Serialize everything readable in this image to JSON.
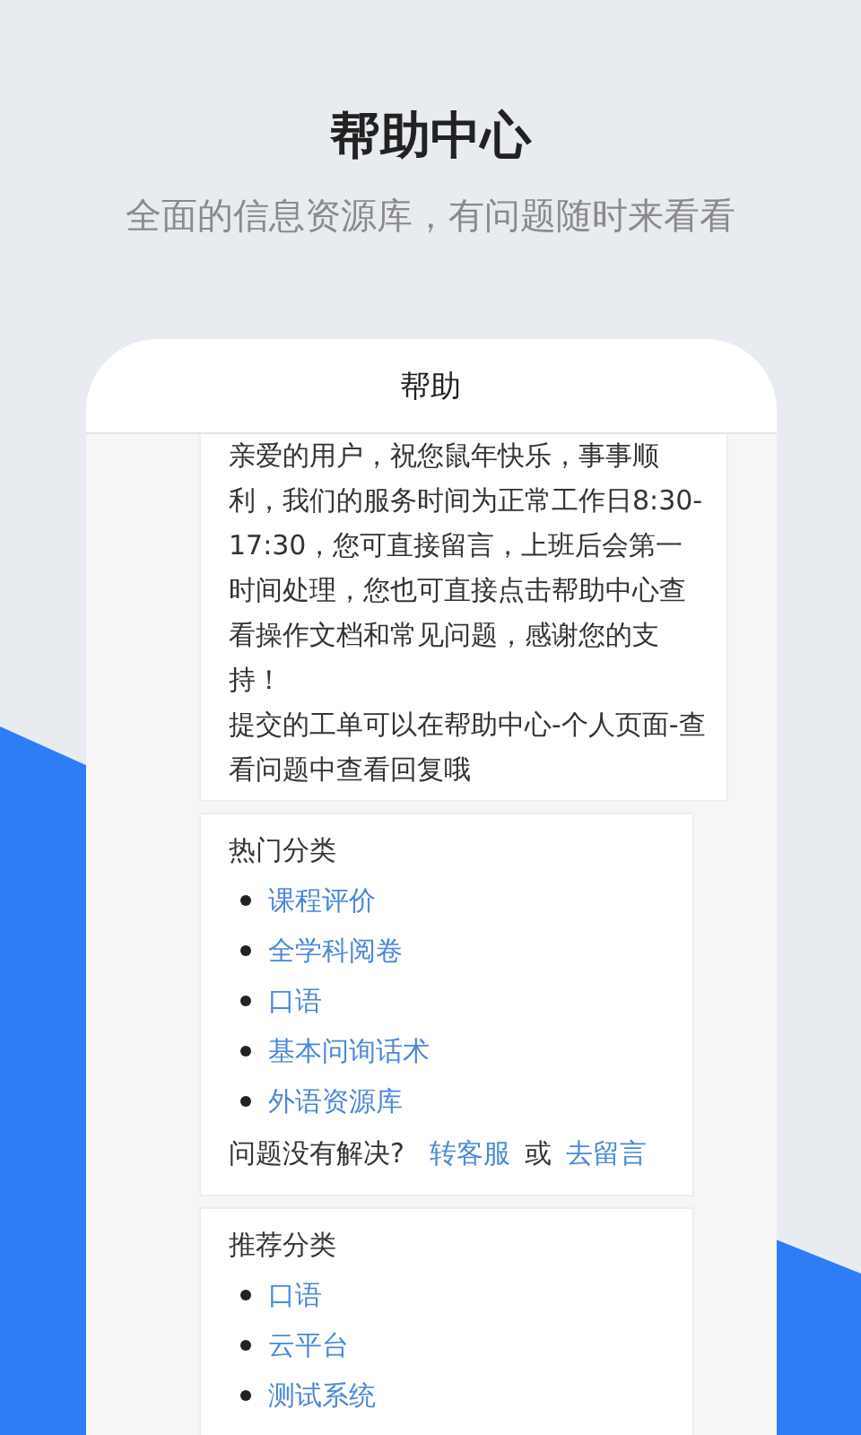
{
  "header": {
    "title": "帮助中心",
    "subtitle": "全面的信息资源库，有问题随时来看看"
  },
  "screen": {
    "title": "帮助",
    "notice": [
      "亲爱的用户，祝您鼠年快乐，事事顺利，我们的服务时间为正常工作日8:30-17:30，您可直接留言，上班后会第一时间处理，您也可直接点击帮助中心查看操作文档和常见问题，感谢您的支持！",
      "提交的工单可以在帮助中心-个人页面-查看问题中查看回复哦"
    ],
    "sections": [
      {
        "heading": "热门分类",
        "links": [
          "课程评价",
          "全学科阅卷",
          "口语",
          "基本问询话术",
          "外语资源库"
        ],
        "footer": {
          "question": "问题没有解决?",
          "contact": "转客服",
          "or": "或",
          "message": "去留言"
        }
      },
      {
        "heading": "推荐分类",
        "links": [
          "口语",
          "云平台",
          "测试系统"
        ]
      }
    ]
  }
}
